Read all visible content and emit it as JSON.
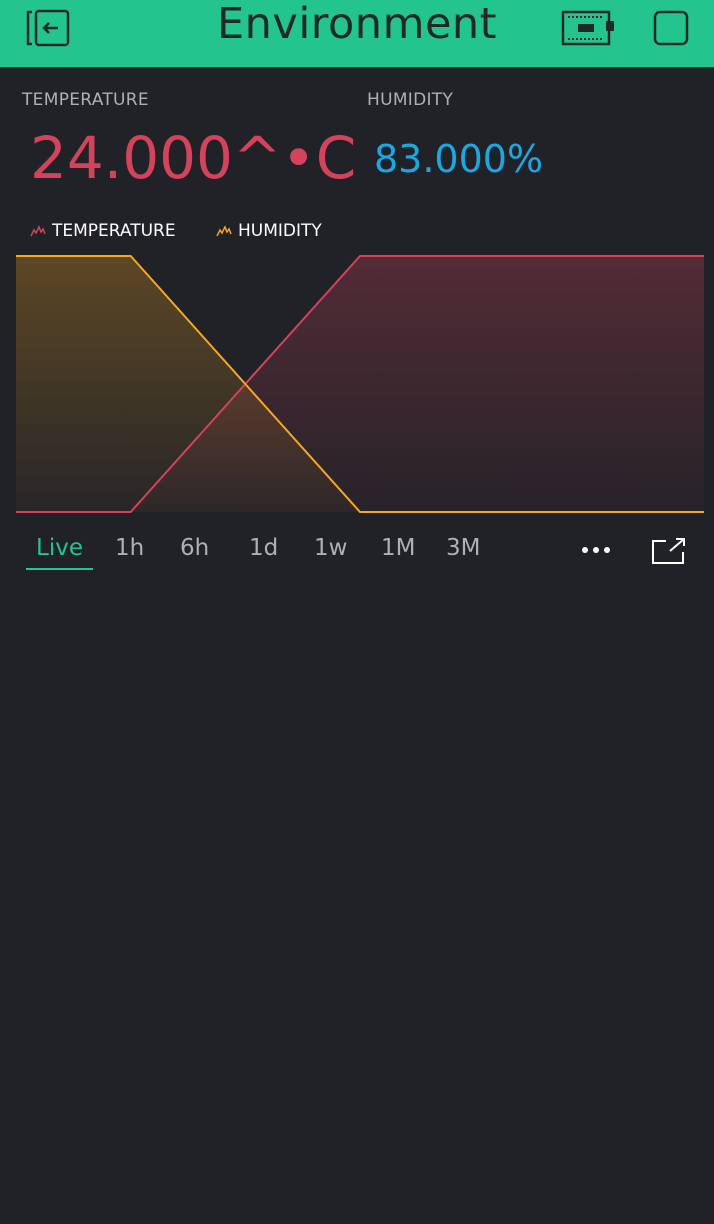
{
  "header": {
    "title": "Environment",
    "background": "#23c48e",
    "left_icon": "exit-icon",
    "right_icons": [
      "device-icon",
      "square-icon"
    ]
  },
  "widgets": {
    "temperature": {
      "label": "TEMPERATURE",
      "value": "24.000^•C",
      "color": "#d3435c"
    },
    "humidity": {
      "label": "HUMIDITY",
      "value": "83.000%",
      "color": "#1ba7e0"
    }
  },
  "chart": {
    "legend": [
      {
        "name": "TEMPERATURE",
        "color": "#d3435c",
        "icon": "chart-line-icon"
      },
      {
        "name": "HUMIDITY",
        "color": "#f5a623",
        "icon": "chart-line-icon"
      }
    ],
    "periods": [
      "Live",
      "1h",
      "6h",
      "1d",
      "1w",
      "1M",
      "3M"
    ],
    "active_period": "Live",
    "more_icon": "more-dots-icon",
    "expand_icon": "expand-icon"
  },
  "chart_data": {
    "type": "area",
    "x": [
      0,
      1,
      2,
      3,
      4,
      5,
      6
    ],
    "series": [
      {
        "name": "TEMPERATURE",
        "color": "#d3435c",
        "values": [
          0,
          0,
          0.5,
          1,
          1,
          1,
          1
        ]
      },
      {
        "name": "HUMIDITY",
        "color": "#f5a623",
        "values": [
          1,
          1,
          0.5,
          0,
          0,
          0,
          0
        ]
      }
    ],
    "ylim": [
      0,
      1
    ],
    "grid": false
  }
}
